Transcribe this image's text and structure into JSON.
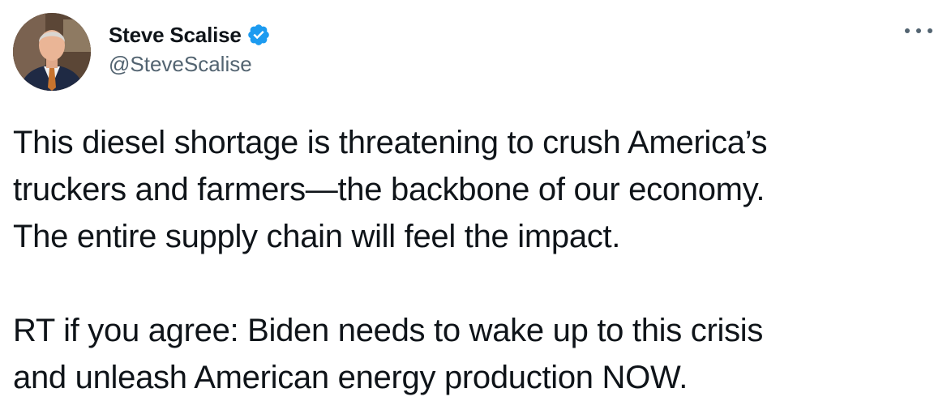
{
  "author": {
    "name": "Steve Scalise",
    "handle": "@SteveScalise",
    "verified_badge_color": "#1d9bf0"
  },
  "icons": {
    "verified": "verified-badge-icon",
    "more": "more-options-icon"
  },
  "tweet": {
    "paragraphs": [
      "This diesel shortage is threatening to crush America’s\ntruckers and farmers—the backbone of our economy.\nThe entire supply chain will feel the impact.",
      "RT if you agree: Biden needs to wake up to this crisis\nand unleash American energy production NOW."
    ]
  }
}
